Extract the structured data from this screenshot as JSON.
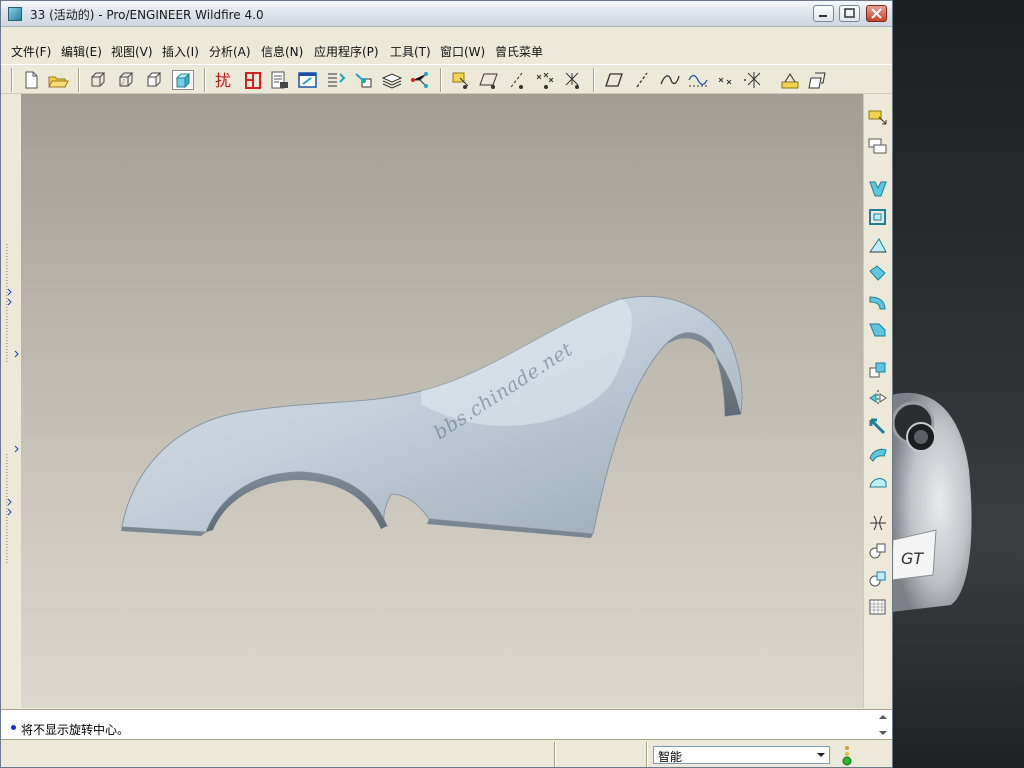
{
  "window": {
    "title": "33 (活动的) - Pro/ENGINEER Wildfire 4.0"
  },
  "menu": [
    {
      "label": "文件(F)"
    },
    {
      "label": "编辑(E)"
    },
    {
      "label": "视图(V)"
    },
    {
      "label": "插入(I)"
    },
    {
      "label": "分析(A)"
    },
    {
      "label": "信息(N)"
    },
    {
      "label": "应用程序(P)"
    },
    {
      "label": "工具(T)"
    },
    {
      "label": "窗口(W)"
    },
    {
      "label": "曾氏菜单"
    }
  ],
  "viewport": {
    "watermark": "bbs.chinade.net"
  },
  "message": {
    "text": "将不显示旋转中心。"
  },
  "status": {
    "filter_value": "智能"
  },
  "colors": {
    "surface": "#c7d3dc",
    "accent_teal": "#18a9c6",
    "toolbar_bg": "#ece9d8",
    "status_green": "#2fb52f"
  }
}
